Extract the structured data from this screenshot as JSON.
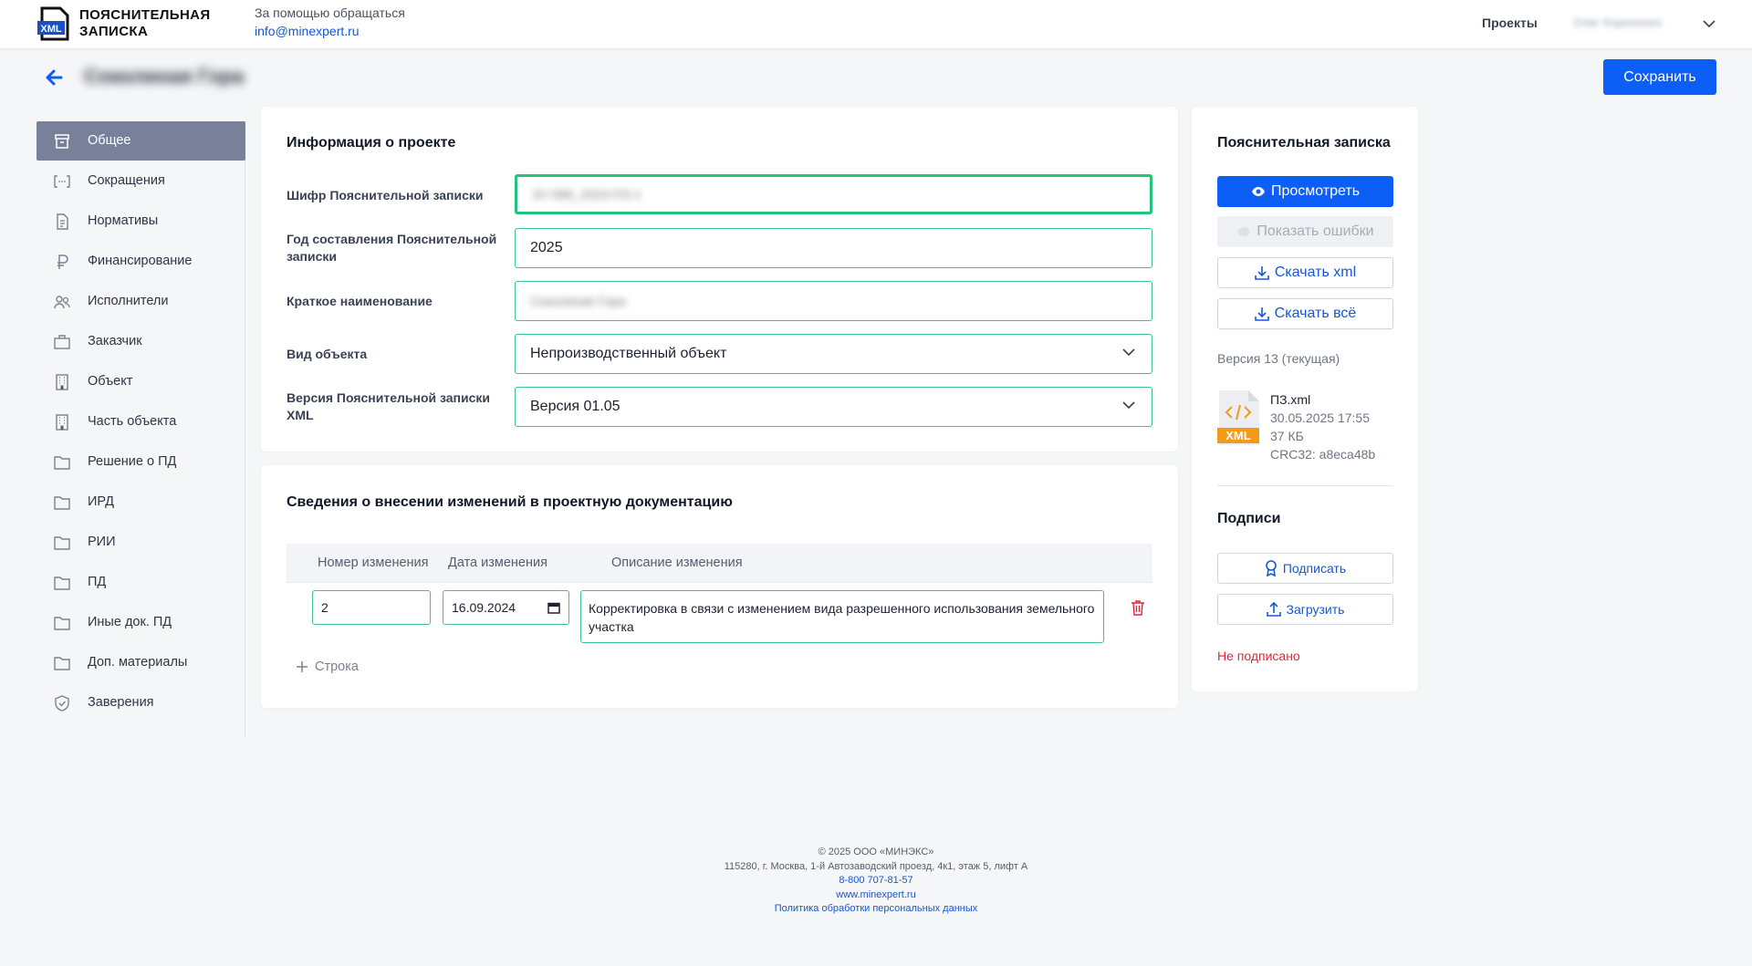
{
  "header": {
    "logo_badge": "XML",
    "logo_line1": "ПОЯСНИТЕЛЬНАЯ",
    "logo_line2": "ЗАПИСКА",
    "help_text": "За помощью обращаться",
    "help_email": "info@minexpert.ru",
    "nav_projects": "Проекты",
    "user_name": "Олег Корнеенко"
  },
  "page": {
    "title": "Соколиная Гора",
    "save_label": "Сохранить"
  },
  "sidebar": {
    "items": [
      {
        "label": "Общее",
        "icon": "archive-icon",
        "active": true
      },
      {
        "label": "Сокращения",
        "icon": "brackets-icon"
      },
      {
        "label": "Нормативы",
        "icon": "document-icon"
      },
      {
        "label": "Финансирование",
        "icon": "ruble-icon"
      },
      {
        "label": "Исполнители",
        "icon": "users-icon"
      },
      {
        "label": "Заказчик",
        "icon": "briefcase-icon"
      },
      {
        "label": "Объект",
        "icon": "building-icon"
      },
      {
        "label": "Часть объекта",
        "icon": "building-icon"
      },
      {
        "label": "Решение о ПД",
        "icon": "folder-icon"
      },
      {
        "label": "ИРД",
        "icon": "folder-icon"
      },
      {
        "label": "РИИ",
        "icon": "folder-icon"
      },
      {
        "label": "ПД",
        "icon": "folder-icon"
      },
      {
        "label": "Иные док. ПД",
        "icon": "folder-icon"
      },
      {
        "label": "Доп. материалы",
        "icon": "folder-icon"
      },
      {
        "label": "Заверения",
        "icon": "shield-check-icon"
      }
    ]
  },
  "project_info": {
    "title": "Информация о проекте",
    "cipher_label": "Шифр Пояснительной записки",
    "cipher_value": "ЗУ-086_2024-ПЗ-1",
    "year_label": "Год составления Пояснительной записки",
    "year_value": "2025",
    "short_name_label": "Краткое наименование",
    "short_name_value": "Соколиная Гора",
    "object_type_label": "Вид объекта",
    "object_type_value": "Непроизводственный объект",
    "xml_version_label": "Версия Пояснительной записки XML",
    "xml_version_value": "Версия 01.05"
  },
  "changes": {
    "title": "Сведения о внесении изменений в проектную документацию",
    "columns": [
      "Номер изменения",
      "Дата изменения",
      "Описание изменения"
    ],
    "rows": [
      {
        "number": "2",
        "date": "16.09.2024",
        "description": "Корректировка в связи с изменением вида разрешенного использования земельного участка"
      }
    ],
    "add_row_label": "Строка"
  },
  "note_panel": {
    "title": "Пояснительная записка",
    "view_label": "Просмотреть",
    "errors_label": "Показать ошибки",
    "download_xml_label": "Скачать xml",
    "download_all_label": "Скачать всё",
    "version_text": "Версия 13 (текущая)",
    "file": {
      "badge": "XML",
      "name": "ПЗ.xml",
      "date": "30.05.2025 17:55",
      "size": "37 КБ",
      "crc": "CRC32: a8eca48b"
    },
    "signatures_title": "Подписи",
    "sign_label": "Подписать",
    "upload_label": "Загрузить",
    "status_text": "Не подписано"
  },
  "footer": {
    "copyright": "© 2025 ООО «МИНЭКС»",
    "address": "115280, г. Москва, 1-й Автозаводский проезд, 4к1, этаж 5, лифт А",
    "phone": "8-800 707-81-57",
    "site": "www.minexpert.ru",
    "privacy": "Политика обработки персональных данных"
  },
  "colors": {
    "primary": "#0d5ef7",
    "field_border": "#3cc48a",
    "sidebar_active": "#78809a",
    "error": "#e4243b"
  }
}
